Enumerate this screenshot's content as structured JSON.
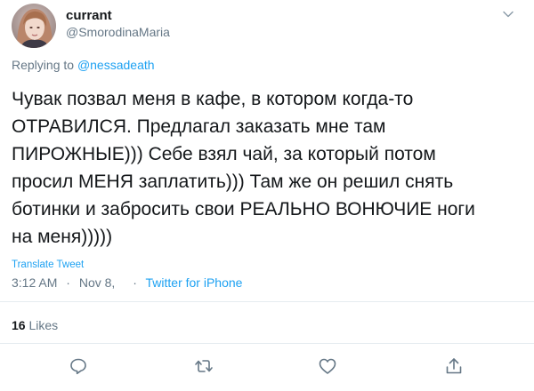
{
  "author": {
    "display_name": "currant",
    "handle": "@SmorodinaMaria"
  },
  "reply": {
    "prefix": "Replying to",
    "mention": "@nessadeath"
  },
  "tweet": {
    "lines": [
      "Чувак позвал меня в кафе, в котором когда-то",
      "ОТРАВИЛСЯ. Предлагал заказать мне там",
      "ПИРОЖНЫЕ))) Себе взял чай, за который потом",
      "просил МЕНЯ заплатить))) Там же он решил снять",
      "ботинки и забросить свои РЕАЛЬНО ВОНЮЧИЕ ноги",
      "на меня)))))"
    ]
  },
  "translate_label": "Translate Tweet",
  "meta": {
    "time": "3:12 AM",
    "date": "Nov 8,",
    "source": "Twitter for iPhone"
  },
  "stats": {
    "likes_count": "16",
    "likes_label": "Likes"
  },
  "actions": {
    "reply": "reply-icon",
    "retweet": "retweet-icon",
    "like": "heart-icon",
    "share": "share-icon"
  },
  "colors": {
    "link": "#1da1f2",
    "secondary": "#657786",
    "text": "#14171a",
    "divider": "#e6ecf0"
  }
}
